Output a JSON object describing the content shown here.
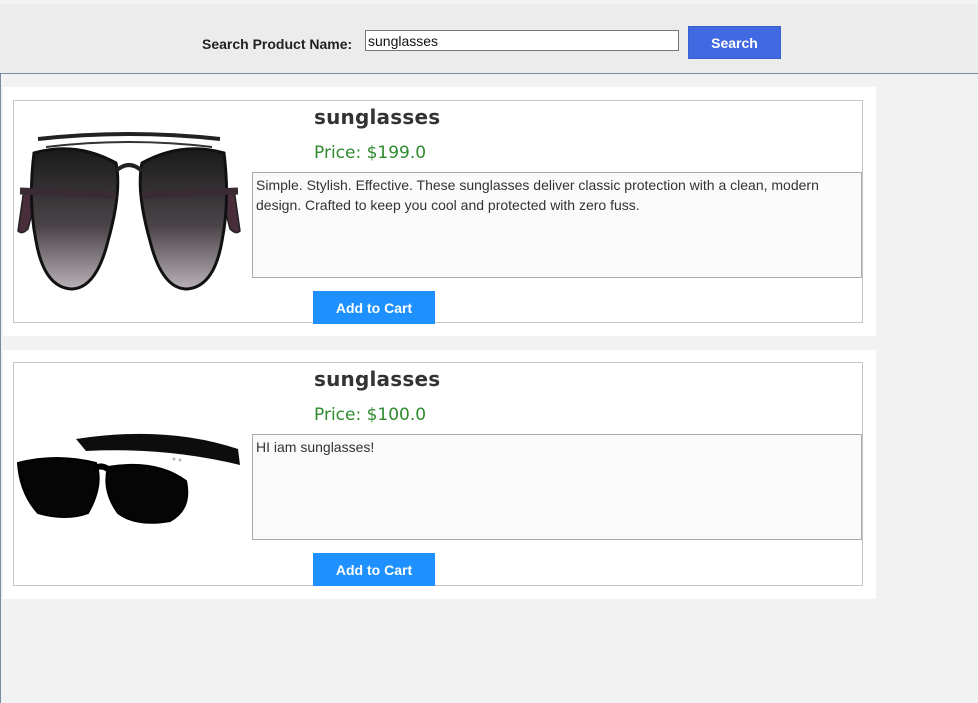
{
  "search": {
    "label": "Search Product Name:",
    "value": "sunglasses",
    "placeholder": "",
    "button_label": "Search"
  },
  "products": [
    {
      "name": "sunglasses",
      "price_prefix": "Price: $",
      "price": "199.0",
      "description": "Simple. Stylish. Effective. These sunglasses deliver classic protection with a clean, modern design. Crafted to keep you cool and protected with zero fuss.",
      "image": "aviator-sunglasses-image",
      "button_label": "Add to Cart"
    },
    {
      "name": "sunglasses",
      "price_prefix": "Price: $",
      "price": "100.0",
      "description": "HI iam sunglasses!",
      "image": "wayfarer-sunglasses-image",
      "button_label": "Add to Cart"
    }
  ],
  "colors": {
    "search_button": "#4169e1",
    "add_cart_button": "#1e90ff",
    "price_text": "#2e8b2e"
  }
}
